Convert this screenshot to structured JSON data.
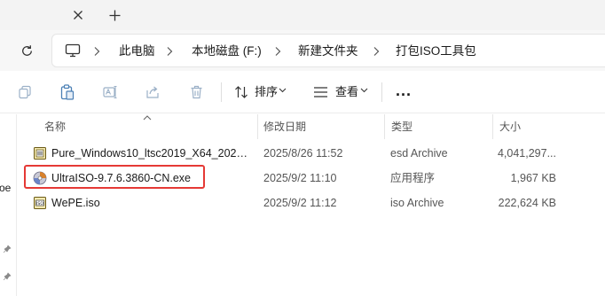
{
  "toolbar": {
    "sort_label": "排序",
    "view_label": "查看",
    "more_label": "..."
  },
  "breadcrumb": [
    "此电脑",
    "本地磁盘 (F:)",
    "新建文件夹",
    "打包ISO工具包"
  ],
  "nav": {
    "partial_label": "oe"
  },
  "columns": {
    "name": "名称",
    "date": "修改日期",
    "type": "类型",
    "size": "大小"
  },
  "files": [
    {
      "name": "Pure_Windows10_ltsc2019_X64_2025....",
      "date": "2025/8/26 11:52",
      "type": "esd Archive",
      "size": "4,041,297..."
    },
    {
      "name": "UltraISO-9.7.6.3860-CN.exe",
      "date": "2025/9/2 11:10",
      "type": "应用程序",
      "size": "1,967 KB"
    },
    {
      "name": "WePE.iso",
      "date": "2025/9/2 11:12",
      "type": "iso Archive",
      "size": "222,624 KB"
    }
  ],
  "colors": {
    "highlight": "#e53935",
    "accent": "#0067c0"
  }
}
